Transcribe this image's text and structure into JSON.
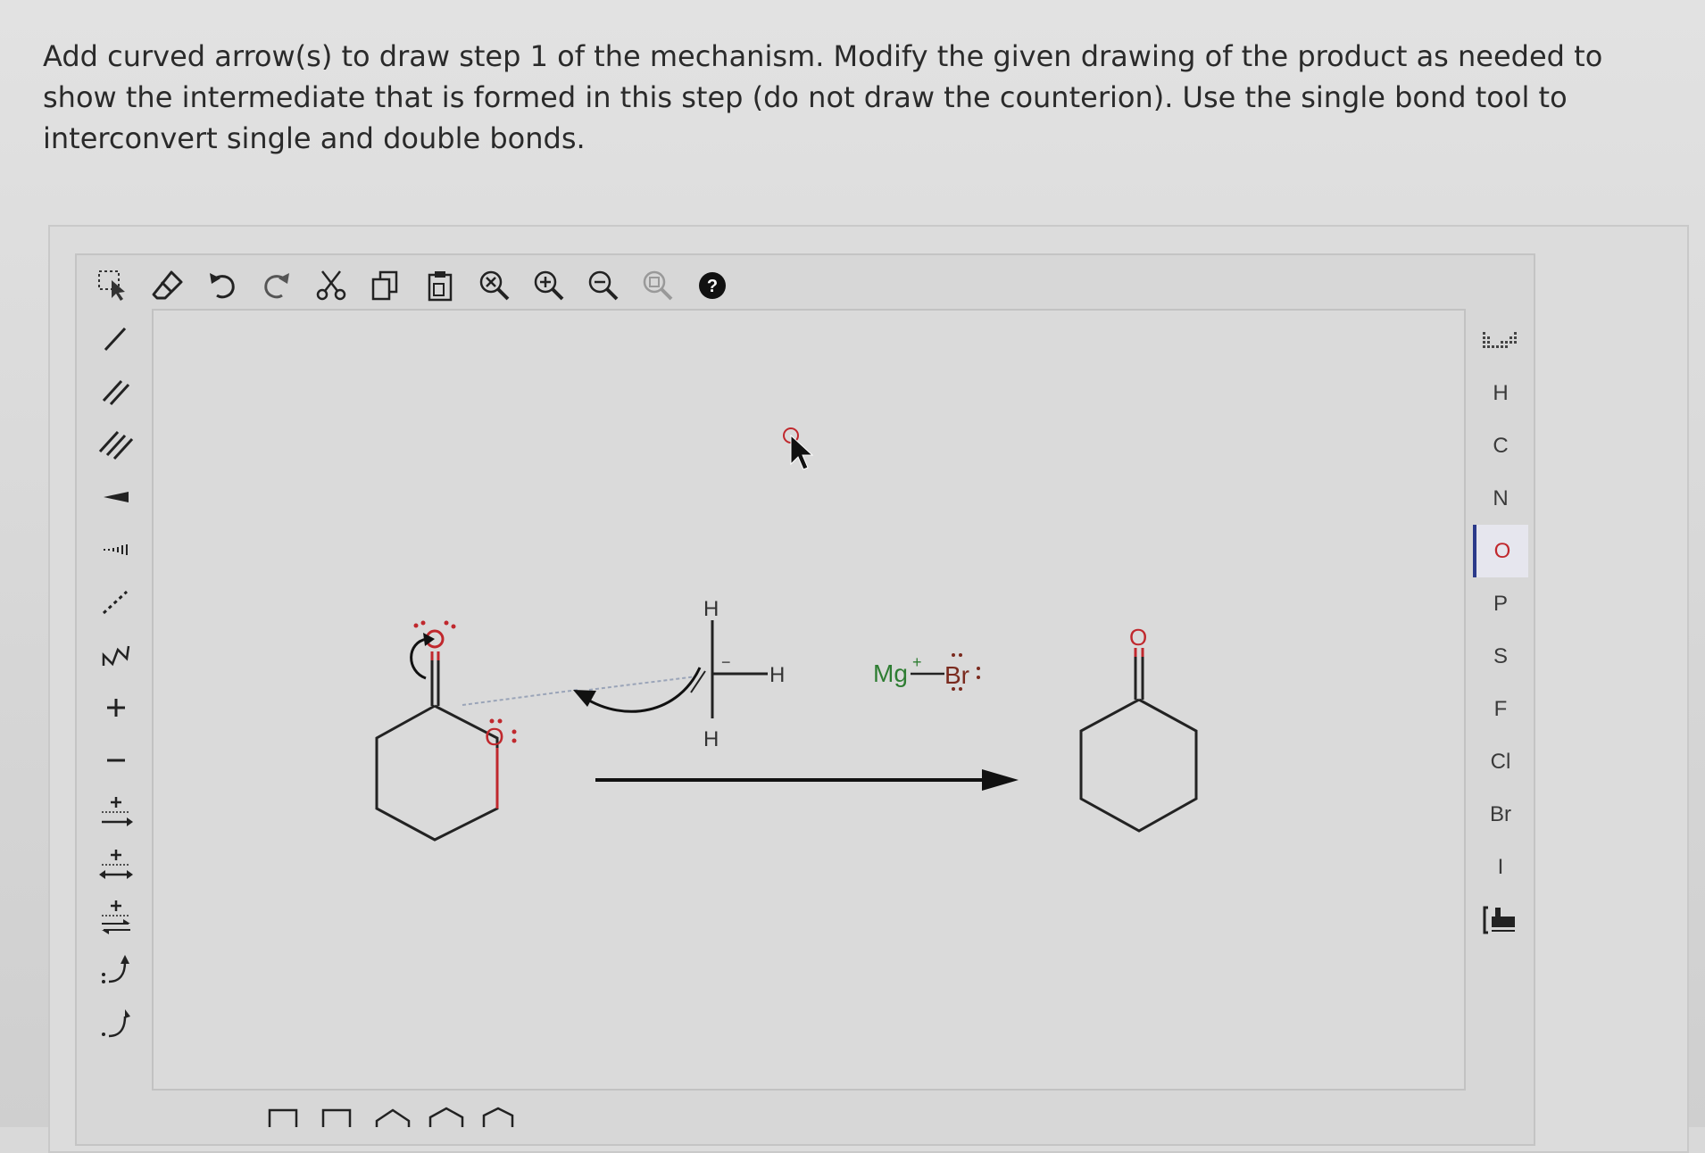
{
  "instructions": "Add curved arrow(s) to draw step 1 of the mechanism. Modify the given drawing of the product as needed to show the intermediate that is formed in this step (do not draw the counterion). Use the single bond tool to interconvert single and double bonds.",
  "toolbar": {
    "tools": [
      {
        "id": "select",
        "icon": "select-lasso-icon"
      },
      {
        "id": "erase",
        "icon": "eraser-icon"
      },
      {
        "id": "undo",
        "icon": "undo-icon"
      },
      {
        "id": "redo",
        "icon": "redo-icon"
      },
      {
        "id": "cut",
        "icon": "scissors-icon"
      },
      {
        "id": "copy",
        "icon": "copy-icon"
      },
      {
        "id": "paste",
        "icon": "paste-icon"
      },
      {
        "id": "zoom-reset",
        "icon": "zoom-reset-icon"
      },
      {
        "id": "zoom-in",
        "icon": "zoom-in-icon"
      },
      {
        "id": "zoom-out",
        "icon": "zoom-out-icon"
      },
      {
        "id": "zoom-fit",
        "icon": "zoom-fit-icon"
      },
      {
        "id": "help",
        "icon": "help-icon"
      }
    ]
  },
  "left_tools": [
    {
      "id": "single-bond",
      "icon": "single-bond-icon"
    },
    {
      "id": "double-bond",
      "icon": "double-bond-icon"
    },
    {
      "id": "triple-bond",
      "icon": "triple-bond-icon"
    },
    {
      "id": "wedge-bond",
      "icon": "wedge-bond-icon"
    },
    {
      "id": "hash-bond",
      "icon": "hash-bond-icon"
    },
    {
      "id": "dashed-bond",
      "icon": "dashed-bond-icon"
    },
    {
      "id": "chain",
      "icon": "chain-icon"
    },
    {
      "id": "charge-plus",
      "label": "+",
      "icon": "plus-icon"
    },
    {
      "id": "charge-minus",
      "label": "−",
      "icon": "minus-icon"
    },
    {
      "id": "reaction-arrow",
      "icon": "reaction-arrow-icon"
    },
    {
      "id": "resonance-arrow",
      "icon": "resonance-arrow-icon"
    },
    {
      "id": "equilibrium-arrow",
      "icon": "equilibrium-arrow-icon"
    },
    {
      "id": "curved-arrow-pair",
      "icon": "curved-arrow-pair-icon"
    },
    {
      "id": "curved-arrow-single",
      "icon": "curved-arrow-single-icon"
    }
  ],
  "elements": [
    "H",
    "C",
    "N",
    "O",
    "P",
    "S",
    "F",
    "Cl",
    "Br",
    "I"
  ],
  "selected_element": "O",
  "molecule_labels": {
    "top_h": "H",
    "right_h": "H",
    "bottom_h": "H",
    "hydride_bar": "−",
    "mg": "Mg",
    "mg_charge": "+",
    "br": "Br",
    "alkoxide_o": "O",
    "product_o": "O",
    "lone_pairs": ":"
  },
  "colors": {
    "oxygen": "#c0282d",
    "magnesium": "#2e7d32",
    "selected_bar": "#2b3a8a",
    "text": "#2a2a2a"
  }
}
